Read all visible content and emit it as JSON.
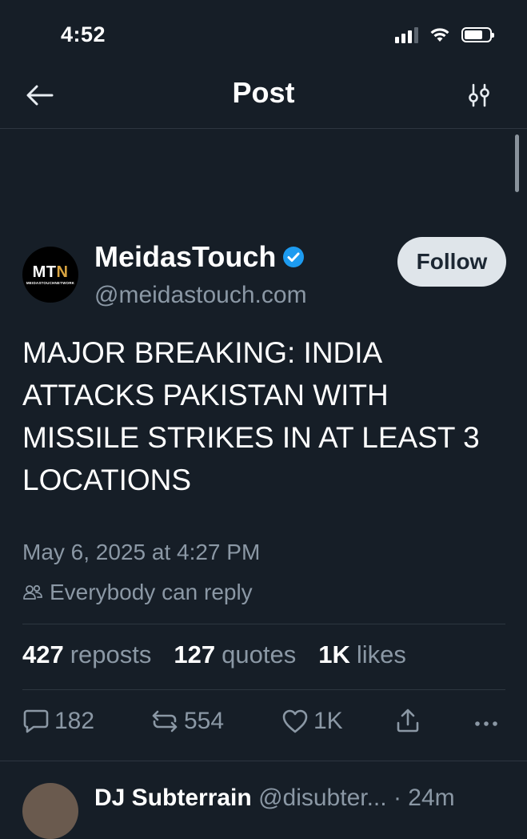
{
  "status_bar": {
    "time": "4:52"
  },
  "nav": {
    "title": "Post"
  },
  "author": {
    "name": "MeidasTouch",
    "handle": "@meidastouch.com",
    "avatar_text_main": "MT",
    "avatar_text_accent": "N",
    "avatar_subtext": "MEIDASTOUCHNETWORK",
    "verified": true,
    "follow_label": "Follow"
  },
  "post": {
    "text": "MAJOR BREAKING: INDIA ATTACKS PAKISTAN WITH MISSILE STRIKES IN AT LEAST 3 LOCATIONS",
    "timestamp": "May 6, 2025 at 4:27 PM",
    "reply_setting": "Everybody can reply"
  },
  "stats": {
    "reposts_value": "427",
    "reposts_label": "reposts",
    "quotes_value": "127",
    "quotes_label": "quotes",
    "likes_value": "1K",
    "likes_label": "likes"
  },
  "actions": {
    "replies": "182",
    "reposts": "554",
    "likes": "1K"
  },
  "reply_preview": {
    "name": "DJ Subterrain",
    "handle": "@disubter...",
    "time": "24m"
  },
  "colors": {
    "background": "#161e27",
    "text_primary": "#ffffff",
    "text_secondary": "#8b98a5",
    "verified_blue": "#1d9bf0",
    "follow_bg": "#dfe5ea",
    "divider": "#2d3640"
  }
}
